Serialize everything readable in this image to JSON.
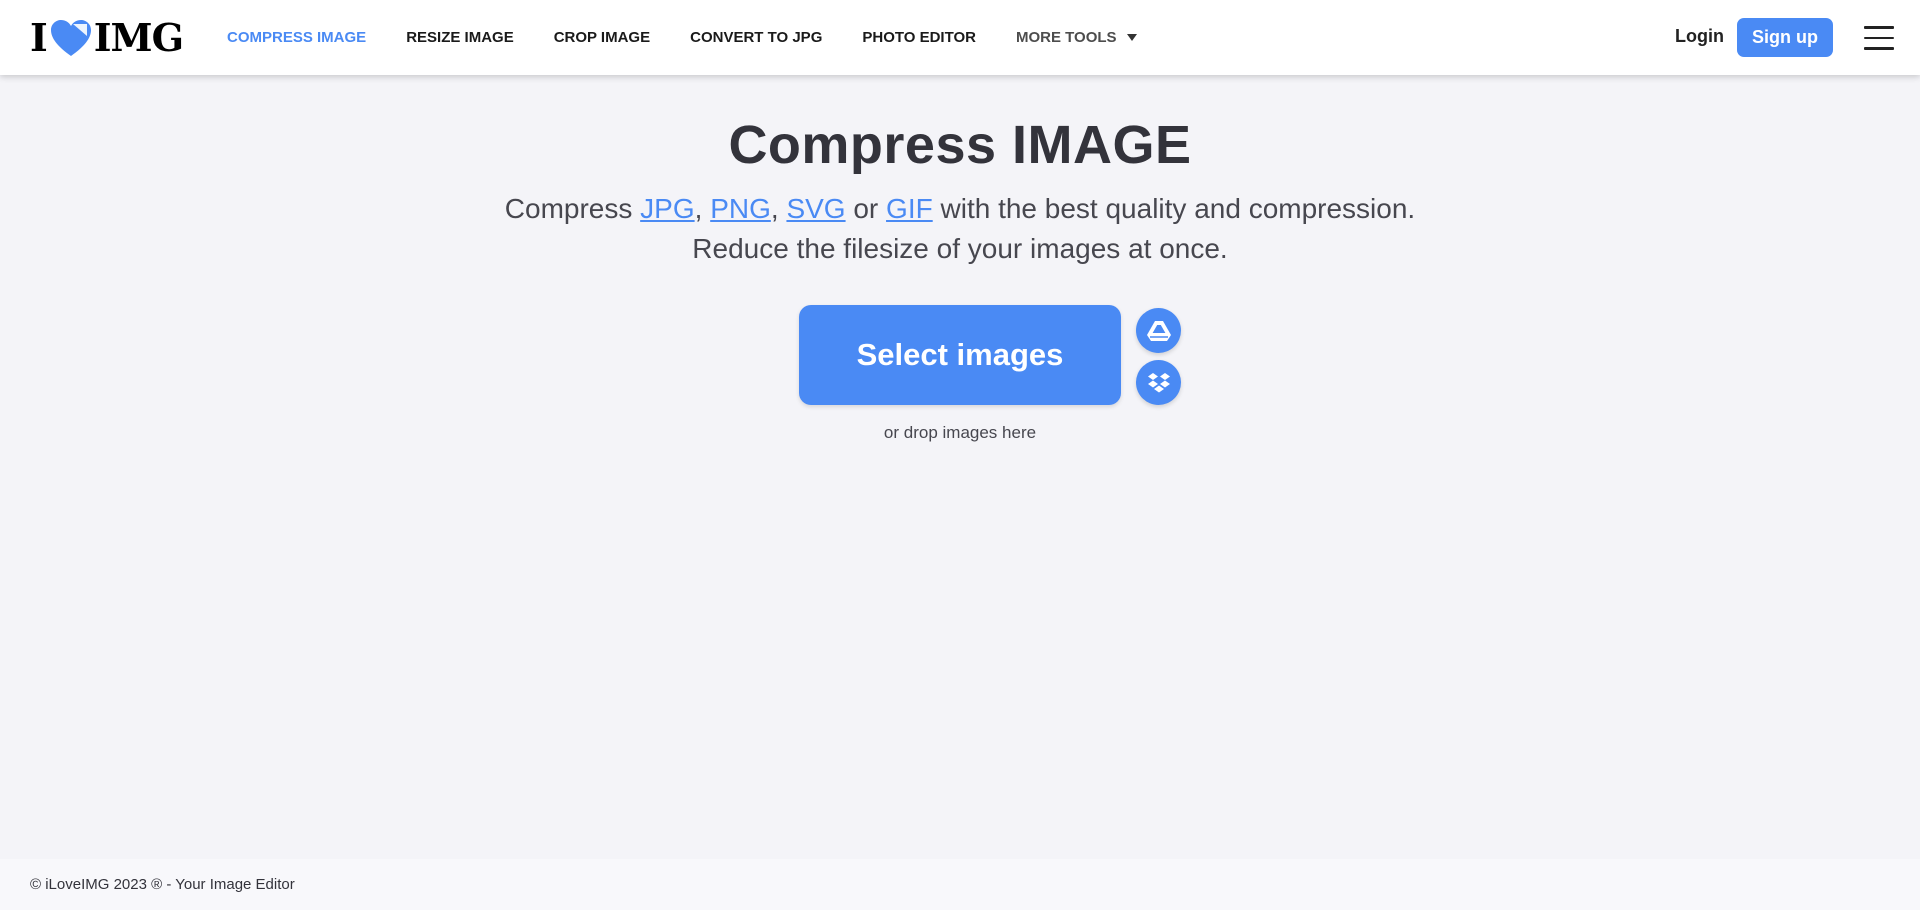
{
  "logo": {
    "left": "I",
    "right": "IMG"
  },
  "nav": {
    "items": [
      {
        "label": "COMPRESS IMAGE"
      },
      {
        "label": "RESIZE IMAGE"
      },
      {
        "label": "CROP IMAGE"
      },
      {
        "label": "CONVERT TO JPG"
      },
      {
        "label": "PHOTO EDITOR"
      },
      {
        "label": "MORE TOOLS"
      }
    ]
  },
  "auth": {
    "login": "Login",
    "signup": "Sign up"
  },
  "main": {
    "title": "Compress IMAGE",
    "sub_prefix": "Compress ",
    "fmt1": "JPG",
    "sep1": ", ",
    "fmt2": "PNG",
    "sep2": ", ",
    "fmt3": "SVG",
    "sep3": " or ",
    "fmt4": "GIF",
    "sub_suffix": " with the best quality and compression.",
    "sub2": "Reduce the filesize of your images at once.",
    "select_button": "Select images",
    "drop_text": "or drop images here"
  },
  "icons": {
    "logo": "heart-icon",
    "more_tools": "caret-down-icon",
    "menu": "hamburger-menu-icon",
    "cloud1": "google-drive-icon",
    "cloud2": "dropbox-icon"
  },
  "colors": {
    "accent": "#4a8af4",
    "background": "#f4f4f8",
    "text": "#33333b"
  },
  "footer": {
    "text": "© iLoveIMG 2023 ® - Your Image Editor"
  }
}
